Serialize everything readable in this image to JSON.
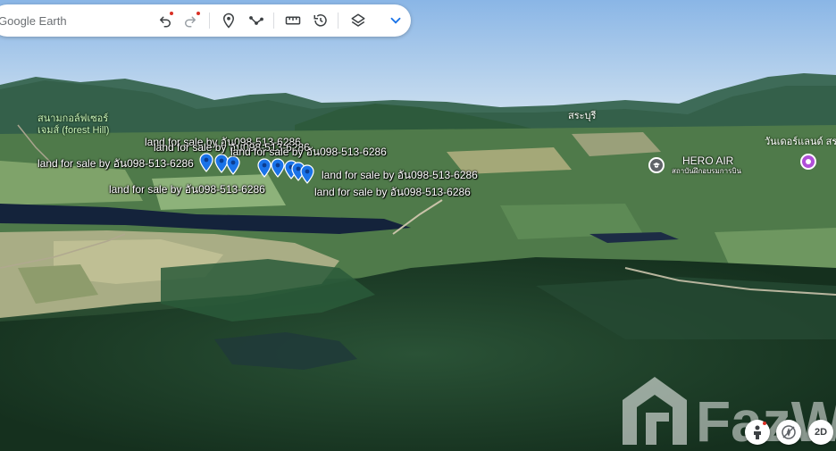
{
  "toolbar": {
    "search_placeholder": "Google Earth",
    "search_prefix_fragment": "ค",
    "icons": [
      "undo-icon",
      "redo-icon",
      "pin-icon",
      "path-icon",
      "ruler-icon",
      "history-icon",
      "layers-icon",
      "chevron-down-icon"
    ]
  },
  "map": {
    "listing_labels": [
      "land for sale by อัน098-513-6286",
      "land for sale by อัน098-513-6286",
      "land for sale by อัน098-513-6286",
      "land for sale by อัน098-513-6286",
      "land for sale by อัน098-513-6286",
      "land for sale by อัน098-513-6286",
      "land for sale by อัน098-513-6286"
    ],
    "places": {
      "golf_line1": "สนามกอล์ฟเซอร์",
      "golf_line2": "เจมส์ (forest Hill)",
      "saraburi": "สระบุรี",
      "wonderland": "วันเดอร์แลนด์ สร"
    },
    "poi": {
      "hero_air_title": "HERO AIR",
      "hero_air_sub": "สถาบันฝึกอบรมการบิน"
    }
  },
  "controls": {
    "view_2d": "2D"
  },
  "watermark_text": "FazWaz",
  "colors": {
    "pin_blue": "#1a73e8",
    "toolbar_bg": "#ffffff",
    "sky": "#9fc3e8",
    "forest": "#1f3d2a"
  }
}
